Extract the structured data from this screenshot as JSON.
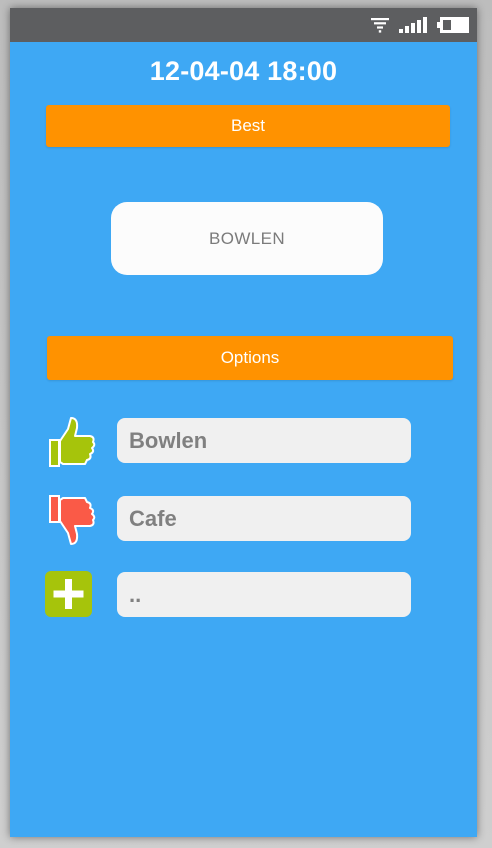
{
  "statusbar": {
    "icons": [
      "wifi-icon",
      "signal-icon",
      "battery-icon"
    ]
  },
  "header": {
    "datetime": "12-04-04 18:00"
  },
  "best": {
    "button_label": "Best",
    "result": "BOWLEN"
  },
  "options": {
    "button_label": "Options",
    "items": [
      {
        "value": "Bowlen",
        "icon": "thumbs-up-icon"
      },
      {
        "value": "Cafe",
        "icon": "thumbs-down-icon"
      },
      {
        "value": "..",
        "icon": "add-icon"
      }
    ]
  },
  "colors": {
    "background": "#3ea8f4",
    "statusbar": "#5d5e60",
    "button": "#ff9200",
    "thumbs_up": "#a6c40b",
    "thumbs_down": "#fa5a47",
    "add": "#a6c40b"
  }
}
